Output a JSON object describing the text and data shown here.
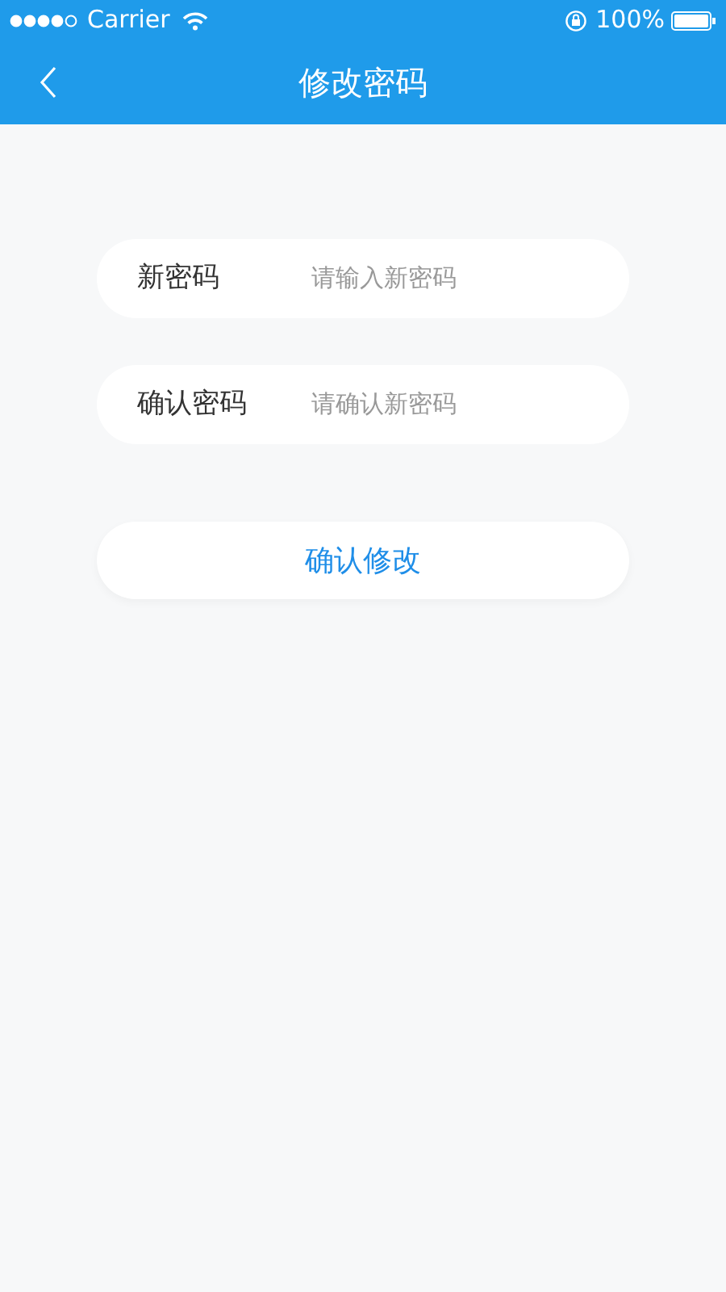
{
  "status_bar": {
    "carrier": "Carrier",
    "battery": "100%"
  },
  "nav_bar": {
    "title": "修改密码"
  },
  "form": {
    "fields": [
      {
        "label": "新密码",
        "placeholder": "请输入新密码"
      },
      {
        "label": "确认密码",
        "placeholder": "请确认新密码"
      }
    ],
    "submit": "确认修改"
  }
}
